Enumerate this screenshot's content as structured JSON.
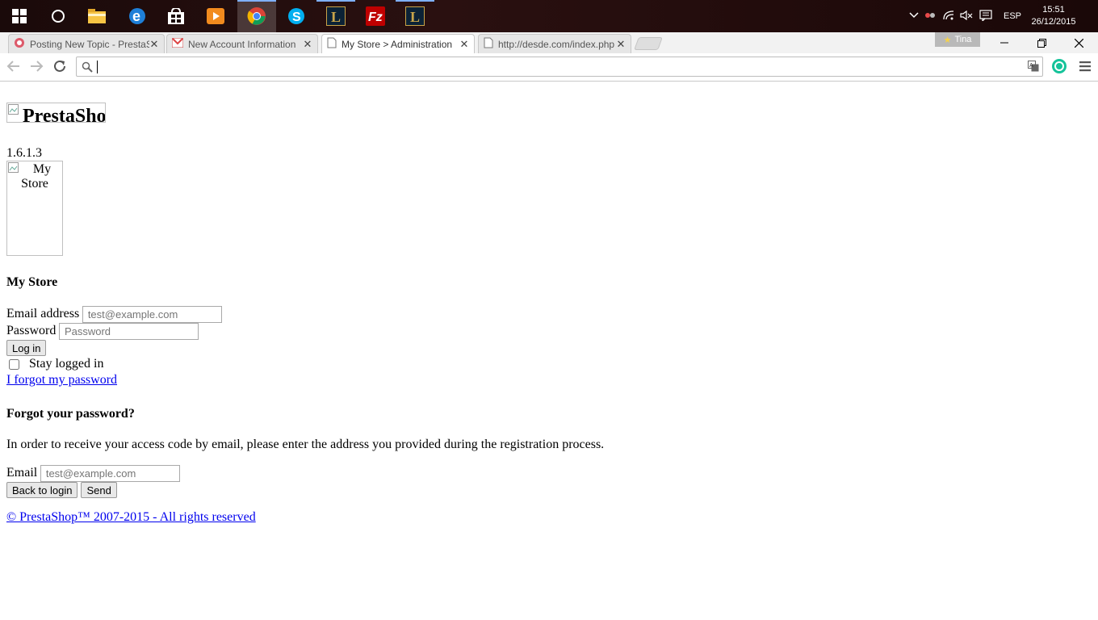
{
  "taskbar": {
    "icons": [
      "windows-start-icon",
      "cortana-icon",
      "file-explorer-icon",
      "edge-icon",
      "store-icon",
      "media-player-icon",
      "chrome-icon",
      "skype-icon",
      "league-icon",
      "filezilla-icon",
      "league-icon-2"
    ],
    "language": "ESP",
    "time": "15:51",
    "date": "26/12/2015"
  },
  "browser": {
    "tabs": [
      {
        "title": "Posting New Topic - PrestaShop",
        "active": false
      },
      {
        "title": "New Account Information",
        "active": false
      },
      {
        "title": "My Store > Administration",
        "active": true
      },
      {
        "title": "http://desde.com/index.php",
        "active": false
      }
    ],
    "profile_name": "Tina",
    "address_value": ""
  },
  "page": {
    "logo_alt": "PrestaShop",
    "version": "1.6.1.3",
    "shop_logo_alt": "My Store",
    "shop_name": "My Store",
    "login": {
      "email_label": "Email address",
      "email_placeholder": " test@example.com",
      "password_label": "Password",
      "password_placeholder": " Password",
      "login_button": "Log in",
      "stay_logged_in": "Stay logged in",
      "forgot_link": "I forgot my password"
    },
    "forgot": {
      "heading": "Forgot your password?",
      "instructions": "In order to receive your access code by email, please enter the address you provided during the registration process.",
      "email_label": "Email",
      "email_placeholder": " test@example.com",
      "back_button": "Back to login",
      "send_button": "Send"
    },
    "footer_link": "© PrestaShop™ 2007-2015 - All rights reserved"
  }
}
